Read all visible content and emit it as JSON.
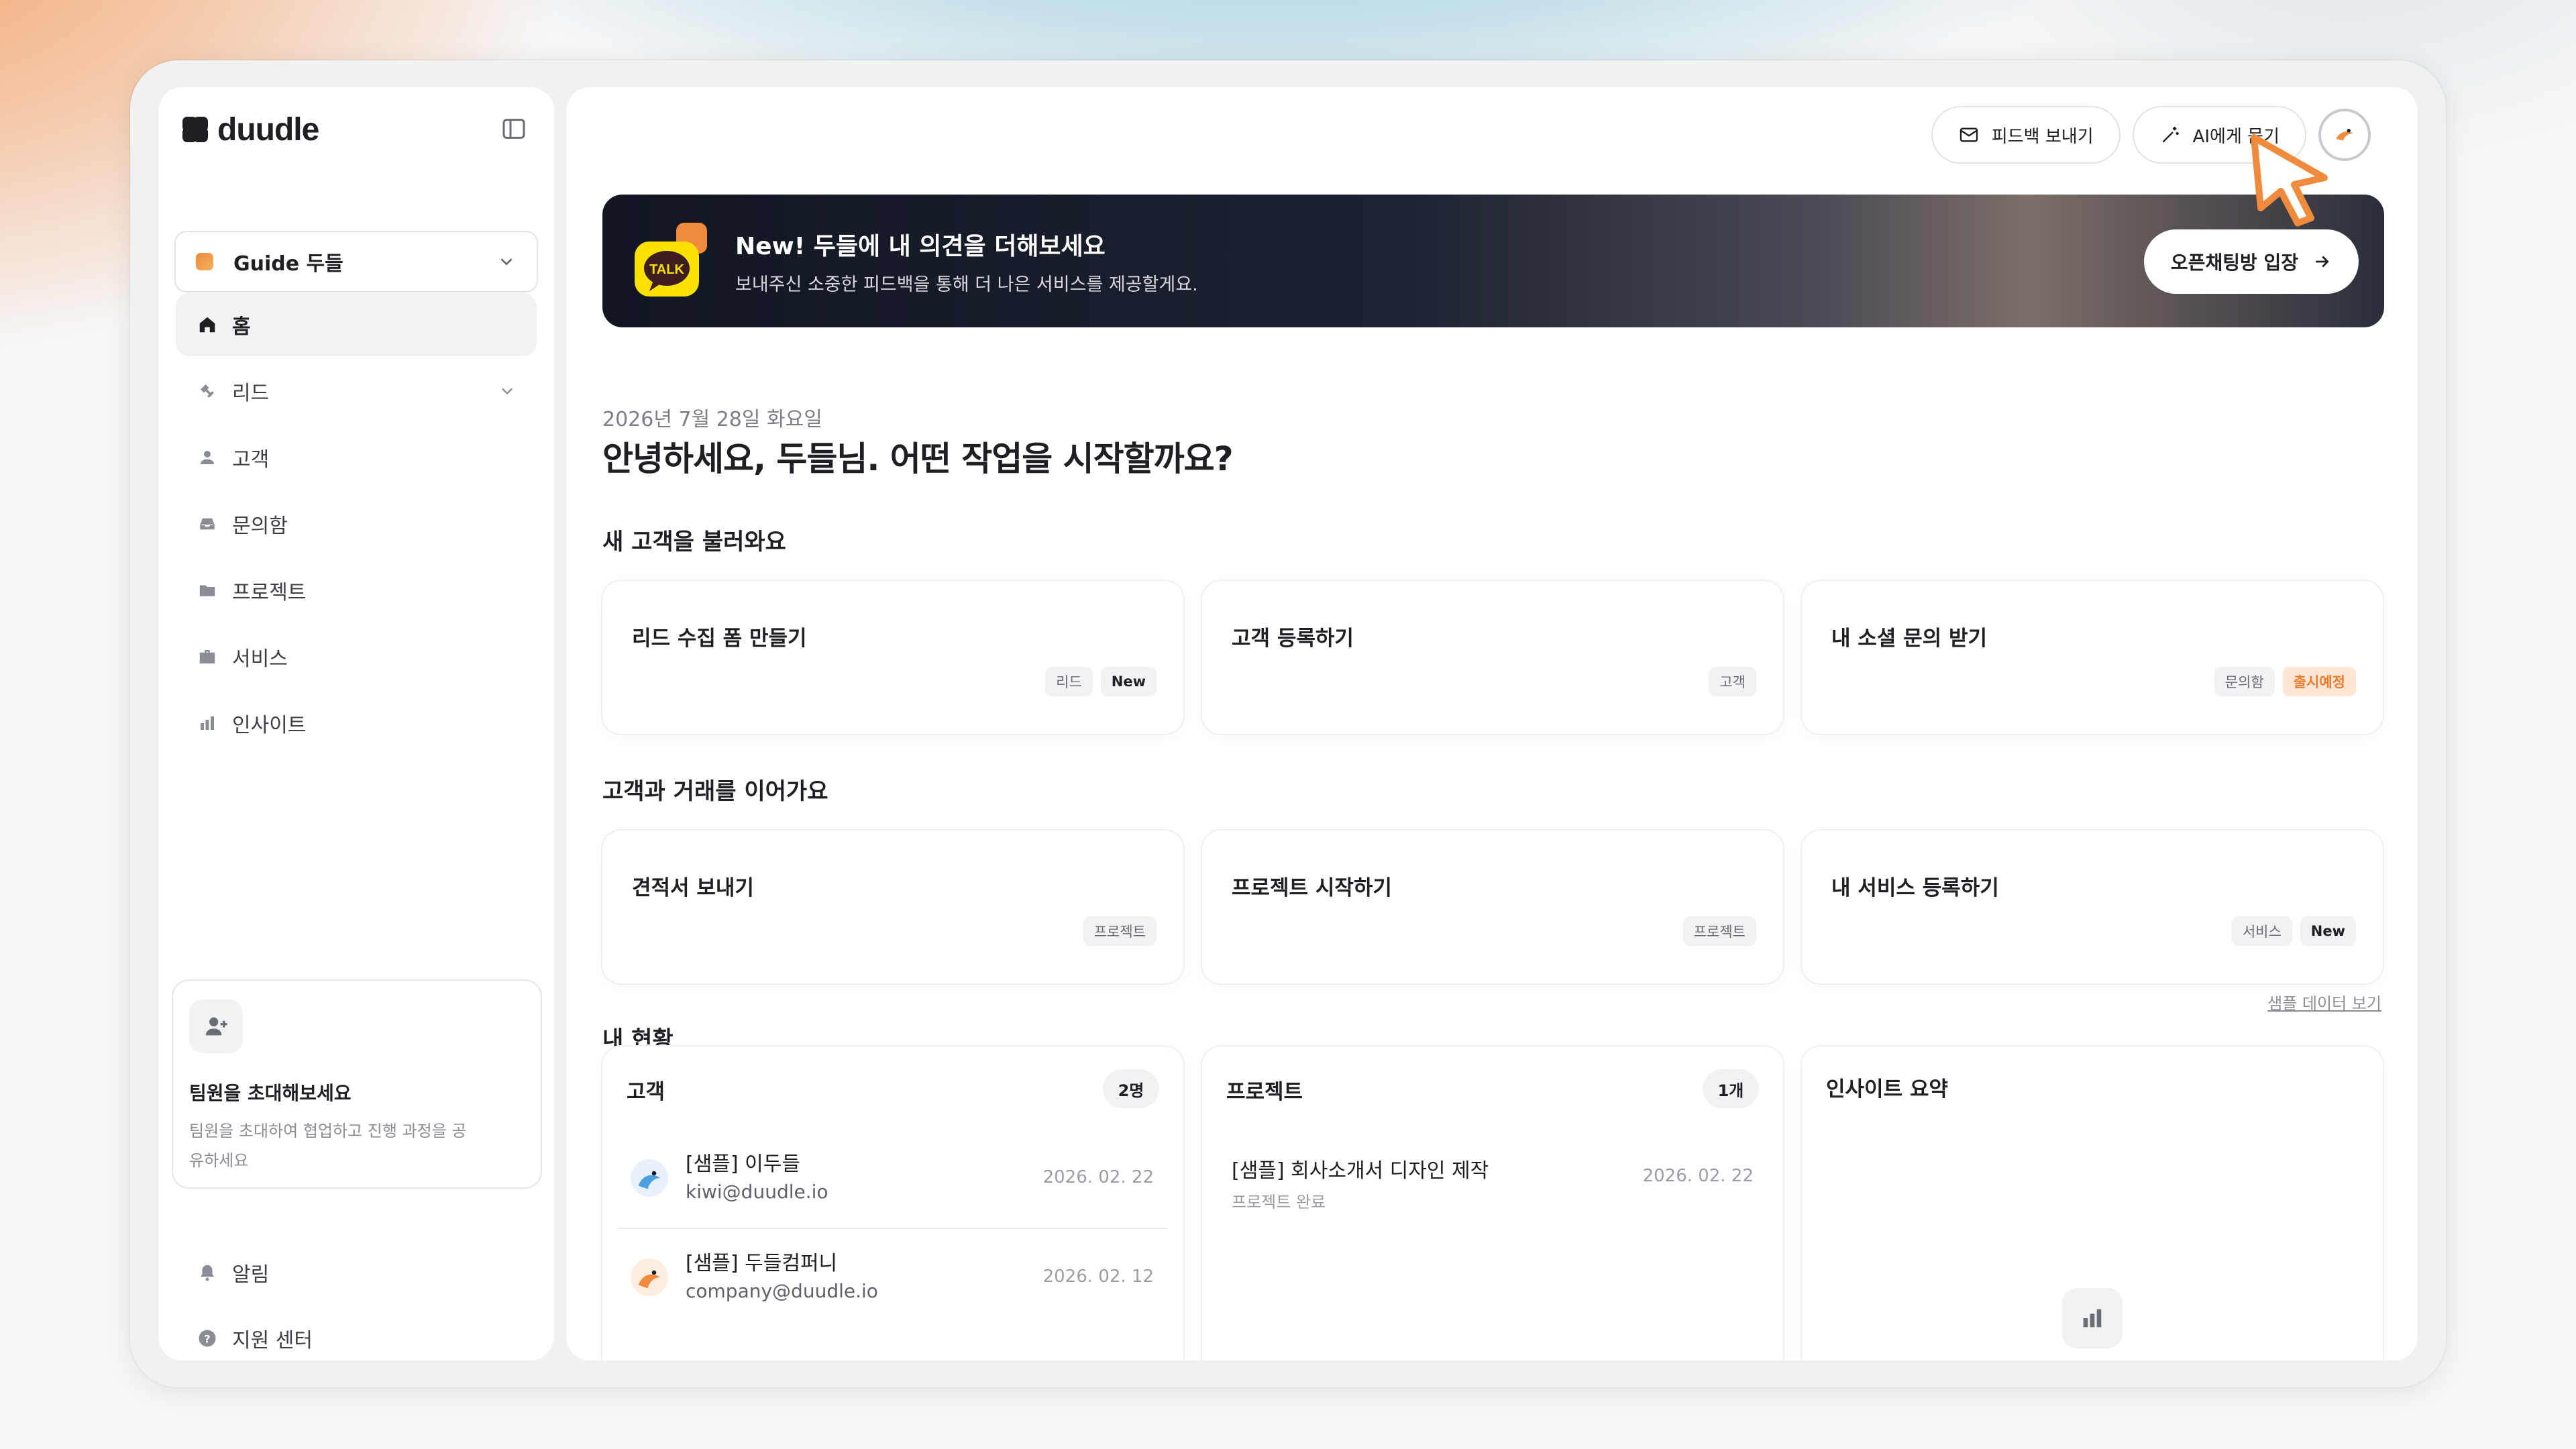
{
  "brand": {
    "name": "duudle"
  },
  "workspace": {
    "label": "Guide 두들"
  },
  "nav": [
    {
      "key": "home",
      "label": "홈",
      "icon": "home-icon",
      "active": true
    },
    {
      "key": "lead",
      "label": "리드",
      "icon": "lead-icon",
      "expandable": true
    },
    {
      "key": "customer",
      "label": "고객",
      "icon": "person-icon"
    },
    {
      "key": "inbox",
      "label": "문의함",
      "icon": "inbox-icon"
    },
    {
      "key": "project",
      "label": "프로젝트",
      "icon": "folder-icon"
    },
    {
      "key": "service",
      "label": "서비스",
      "icon": "briefcase-icon"
    },
    {
      "key": "insight",
      "label": "인사이트",
      "icon": "bar-chart-icon"
    }
  ],
  "invite": {
    "title": "팀원을 초대해보세요",
    "desc": "팀원을 초대하여 협업하고 진행 과정을 공유하세요"
  },
  "bottom_nav": [
    {
      "key": "alerts",
      "label": "알림",
      "icon": "bell-icon"
    },
    {
      "key": "support",
      "label": "지원 센터",
      "icon": "help-icon"
    }
  ],
  "header": {
    "feedback_label": "피드백 보내기",
    "ask_ai_label": "AI에게 묻기"
  },
  "banner": {
    "title": "New! 두들에 내 의견을 더해보세요",
    "subtitle": "보내주신 소중한 피드백을 통해 더 나은 서비스를 제공할게요.",
    "cta": "오픈채팅방 입장",
    "logo_text": "TALK"
  },
  "greeting": {
    "date": "2026년 7월 28일 화요일",
    "title": "안녕하세요, 두들님. 어떤 작업을 시작할까요?"
  },
  "section_new_customers": {
    "title": "새 고객을 불러와요",
    "cards": [
      {
        "title": "리드 수집 폼 만들기",
        "tags": [
          {
            "text": "리드",
            "kind": "plain"
          },
          {
            "text": "New",
            "kind": "new"
          }
        ]
      },
      {
        "title": "고객 등록하기",
        "tags": [
          {
            "text": "고객",
            "kind": "plain"
          }
        ]
      },
      {
        "title": "내 소셜 문의 받기",
        "tags": [
          {
            "text": "문의함",
            "kind": "plain"
          },
          {
            "text": "출시예정",
            "kind": "soon"
          }
        ]
      }
    ]
  },
  "section_deals": {
    "title": "고객과 거래를 이어가요",
    "cards": [
      {
        "title": "견적서 보내기",
        "tags": [
          {
            "text": "프로젝트",
            "kind": "plain"
          }
        ]
      },
      {
        "title": "프로젝트 시작하기",
        "tags": [
          {
            "text": "프로젝트",
            "kind": "plain"
          }
        ]
      },
      {
        "title": "내 서비스 등록하기",
        "tags": [
          {
            "text": "서비스",
            "kind": "plain"
          },
          {
            "text": "New",
            "kind": "new"
          }
        ]
      }
    ]
  },
  "status": {
    "title": "내 현황",
    "sample_link": "샘플 데이터 보기",
    "customers": {
      "title": "고객",
      "count": "2명",
      "rows": [
        {
          "name": "[샘플] 이두들",
          "email": "kiwi@duudle.io",
          "date": "2026. 02. 22",
          "avatar_color": "#4a9fe0"
        },
        {
          "name": "[샘플] 두들컴퍼니",
          "email": "company@duudle.io",
          "date": "2026. 02. 12",
          "avatar_color": "#f08a3c"
        }
      ]
    },
    "projects": {
      "title": "프로젝트",
      "count": "1개",
      "rows": [
        {
          "name": "[샘플] 회사소개서 디자인 제작",
          "status": "프로젝트 완료",
          "date": "2026. 02. 22"
        }
      ]
    },
    "insights": {
      "title": "인사이트 요약"
    }
  },
  "colors": {
    "accent_orange": "#ef7a2d",
    "banner_dark": "#121623",
    "text_primary": "#1d1f23"
  }
}
